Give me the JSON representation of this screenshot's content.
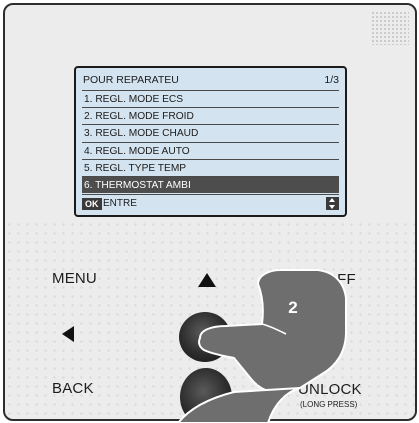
{
  "screen": {
    "title": "POUR REPARATEU",
    "page": "1/3",
    "items": [
      {
        "label": "1. REGL. MODE ECS"
      },
      {
        "label": "2. REGL. MODE FROID"
      },
      {
        "label": "3. REGL. MODE CHAUD"
      },
      {
        "label": "4. REGL. MODE AUTO"
      },
      {
        "label": "5. REGL. TYPE TEMP"
      },
      {
        "label": "6. THERMOSTAT AMBI"
      }
    ],
    "selected_index": 5,
    "footer": {
      "ok_label": "OK",
      "action_label": "ENTRE",
      "scroll_icon": "up-down-arrows-icon"
    }
  },
  "buttons": {
    "menu": "MENU",
    "on_off": "ON/OFF",
    "back": "BACK",
    "unlock": "UNLOCK",
    "unlock_hint": "(LONG PRESS)",
    "up_icon": "up-arrow-icon",
    "left_icon": "left-arrow-icon",
    "right_icon": "right-arrow-icon",
    "ok_button": "round-ok-button",
    "down_button": "round-down-button"
  },
  "overlay": {
    "step_number": "2",
    "hand_icon": "pointing-hand-icon"
  },
  "colors": {
    "screen_bg": "#d3e3ef",
    "selected_row": "#4d4d4d",
    "device_bg": "#ececec",
    "hand": "#6e6e6e"
  }
}
